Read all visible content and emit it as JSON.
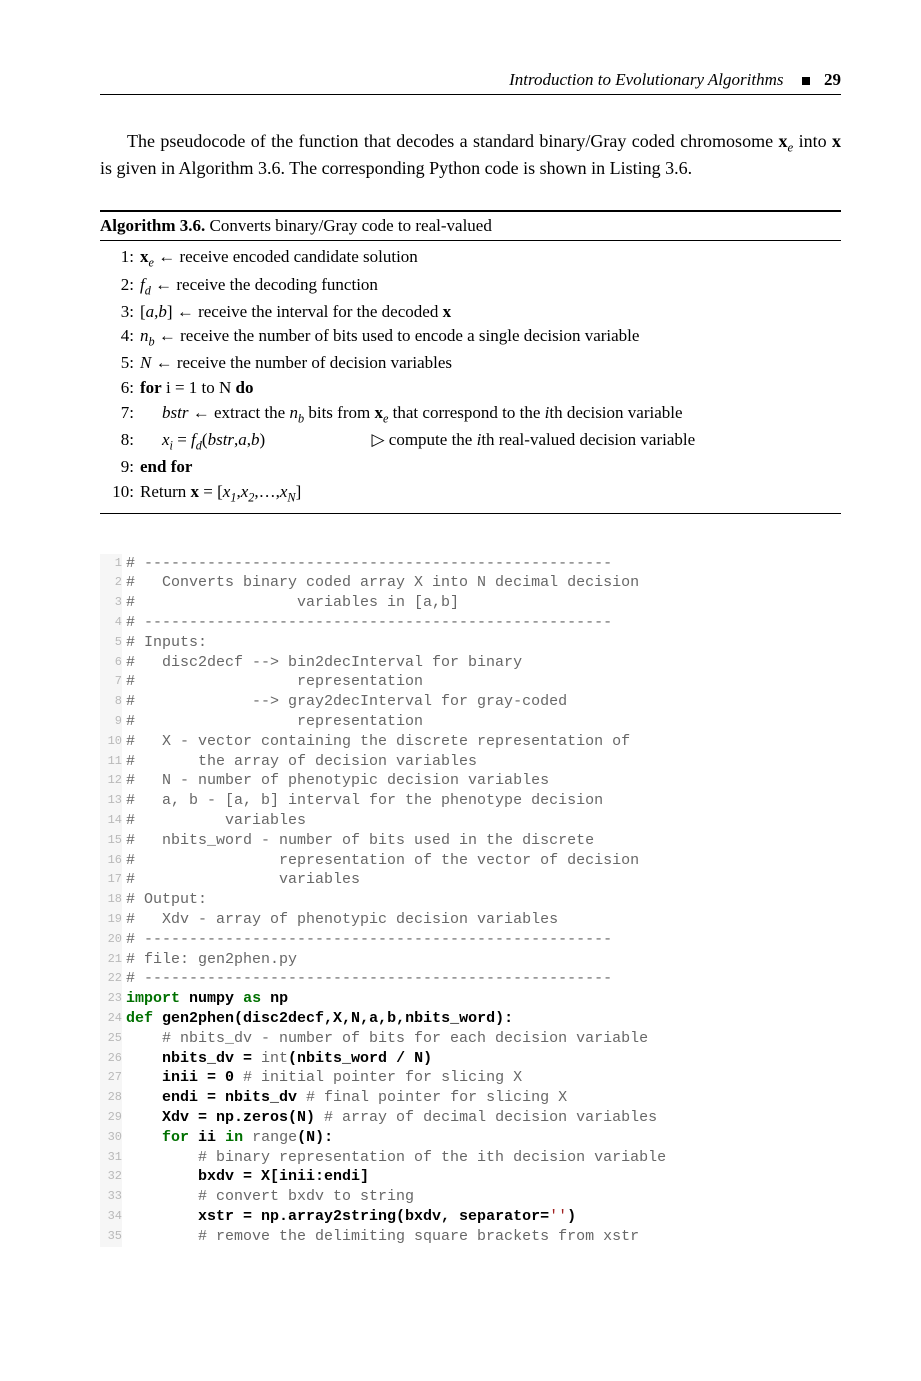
{
  "header": {
    "title": "Introduction to Evolutionary Algorithms",
    "page": "29"
  },
  "paragraph": "The pseudocode of the function that decodes a standard binary/Gray coded chromosome x_e into x is given in Algorithm 3.6. The corresponding Python code is shown in Listing 3.6.",
  "algorithm": {
    "label": "Algorithm 3.6.",
    "caption": "Converts binary/Gray code to real-valued",
    "steps": [
      "x_e ← receive encoded candidate solution",
      "f_d ← receive the decoding function",
      "[a,b] ← receive the interval for the decoded x",
      "n_b ← receive the number of bits used to encode a single decision variable",
      "N ← receive the number of decision variables",
      "for i = 1 to N do",
      "    bstr ← extract the n_b bits from x_e that correspond to the ith decision variable",
      "    x_i = f_d(bstr, a, b)        ▷ compute the ith real-valued decision variable",
      "end for",
      "Return x = [x_1, x_2, …, x_N]"
    ]
  },
  "code_lines": [
    "# ----------------------------------------------------",
    "#   Converts binary coded array X into N decimal decision",
    "#                  variables in [a,b]",
    "# ----------------------------------------------------",
    "# Inputs:",
    "#   disc2decf --> bin2decInterval for binary",
    "#                  representation",
    "#             --> gray2decInterval for gray-coded",
    "#                  representation",
    "#   X - vector containing the discrete representation of",
    "#       the array of decision variables",
    "#   N - number of phenotypic decision variables",
    "#   a, b - [a, b] interval for the phenotype decision",
    "#          variables",
    "#   nbits_word - number of bits used in the discrete",
    "#                representation of the vector of decision",
    "#                variables",
    "# Output:",
    "#   Xdv - array of phenotypic decision variables",
    "# ----------------------------------------------------",
    "# file: gen2phen.py",
    "# ----------------------------------------------------",
    "import numpy as np",
    "def gen2phen(disc2decf,X,N,a,b,nbits_word):",
    "    # nbits_dv - number of bits for each decision variable",
    "    nbits_dv = int(nbits_word / N)",
    "    inii = 0 # initial pointer for slicing X",
    "    endi = nbits_dv # final pointer for slicing X",
    "    Xdv = np.zeros(N) # array of decimal decision variables",
    "    for ii in range(N):",
    "        # binary representation of the ith decision variable",
    "        bxdv = X[inii:endi]",
    "        # convert bxdv to string",
    "        xstr = np.array2string(bxdv, separator='')",
    "        # remove the delimiting square brackets from xstr"
  ]
}
